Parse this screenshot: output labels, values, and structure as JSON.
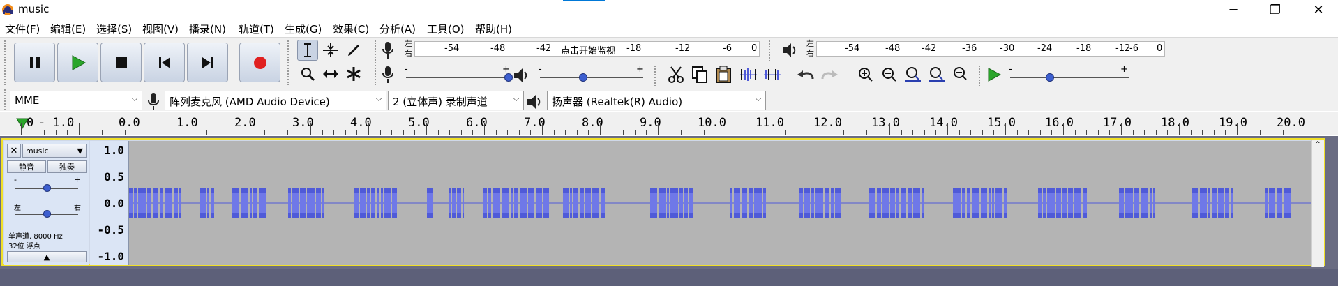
{
  "window": {
    "title": "music",
    "minimize": "─",
    "maximize": "❐",
    "close": "✕"
  },
  "menu": [
    "文件(F)",
    "编辑(E)",
    "选择(S)",
    "视图(V)",
    "播录(N)",
    "轨道(T)",
    "生成(G)",
    "效果(C)",
    "分析(A)",
    "工具(O)",
    "帮助(H)"
  ],
  "transport": {
    "pause": "Pause",
    "play": "Play",
    "stop": "Stop",
    "skip_start": "Skip to Start",
    "skip_end": "Skip to End",
    "record": "Record"
  },
  "meters": {
    "record_labels": [
      "-54",
      "-48",
      "-42",
      "-18",
      "-12",
      "-6",
      "0"
    ],
    "record_hint": "点击开始监视",
    "playback_labels": [
      "-54",
      "-48",
      "-42",
      "-36",
      "-30",
      "-24",
      "-18",
      "-12",
      "-6",
      "0"
    ],
    "lr": [
      "左",
      "右"
    ]
  },
  "sliders": {
    "minus": "-",
    "plus": "+"
  },
  "devices": {
    "host": "MME",
    "recording": "阵列麦克风 (AMD Audio Device)",
    "channels": "2 (立体声) 录制声道",
    "playback": "扬声器 (Realtek(R) Audio)"
  },
  "ruler": {
    "labels": [
      "0",
      "- 1.0",
      "0.0",
      "1.0",
      "2.0",
      "3.0",
      "4.0",
      "5.0",
      "6.0",
      "7.0",
      "8.0",
      "9.0",
      "10.0",
      "11.0",
      "12.0",
      "13.0",
      "14.0",
      "15.0",
      "16.0",
      "17.0",
      "18.0",
      "19.0",
      "20.0"
    ]
  },
  "track": {
    "name": "music",
    "close": "✕",
    "mute": "静音",
    "solo": "独奏",
    "gain_minus": "-",
    "gain_plus": "+",
    "pan_left": "左",
    "pan_right": "右",
    "info_line1": "单声道, 8000 Hz",
    "info_line2": "32位 浮点",
    "collapse": "▲",
    "scale": [
      "1.0",
      "0.5",
      "0.0",
      "-0.5",
      "-1.0"
    ]
  },
  "waveform": {
    "color": "#4f5ad8",
    "background": "#b4b4b4"
  },
  "colors": {
    "track_border": "#f0e028",
    "record_red": "#e02020",
    "play_green": "#2aa52a"
  }
}
